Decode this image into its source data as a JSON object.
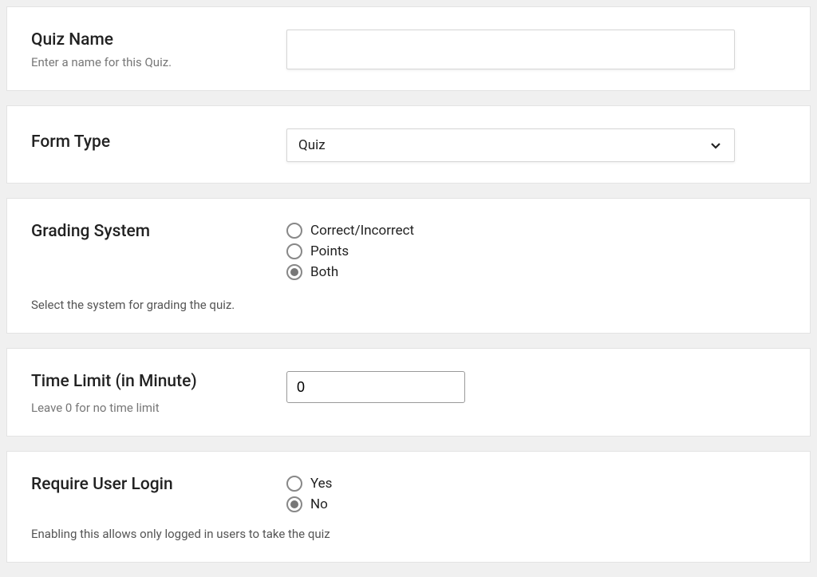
{
  "quizName": {
    "label": "Quiz Name",
    "help": "Enter a name for this Quiz.",
    "value": ""
  },
  "formType": {
    "label": "Form Type",
    "selected": "Quiz"
  },
  "gradingSystem": {
    "label": "Grading System",
    "help": "Select the system for grading the quiz.",
    "options": {
      "0": {
        "label": "Correct/Incorrect"
      },
      "1": {
        "label": "Points"
      },
      "2": {
        "label": "Both"
      }
    },
    "selectedIndex": 2
  },
  "timeLimit": {
    "label": "Time Limit (in Minute)",
    "help": "Leave 0 for no time limit",
    "value": "0"
  },
  "requireLogin": {
    "label": "Require User Login",
    "help": "Enabling this allows only logged in users to take the quiz",
    "options": {
      "0": {
        "label": "Yes"
      },
      "1": {
        "label": "No"
      }
    },
    "selectedIndex": 1
  }
}
